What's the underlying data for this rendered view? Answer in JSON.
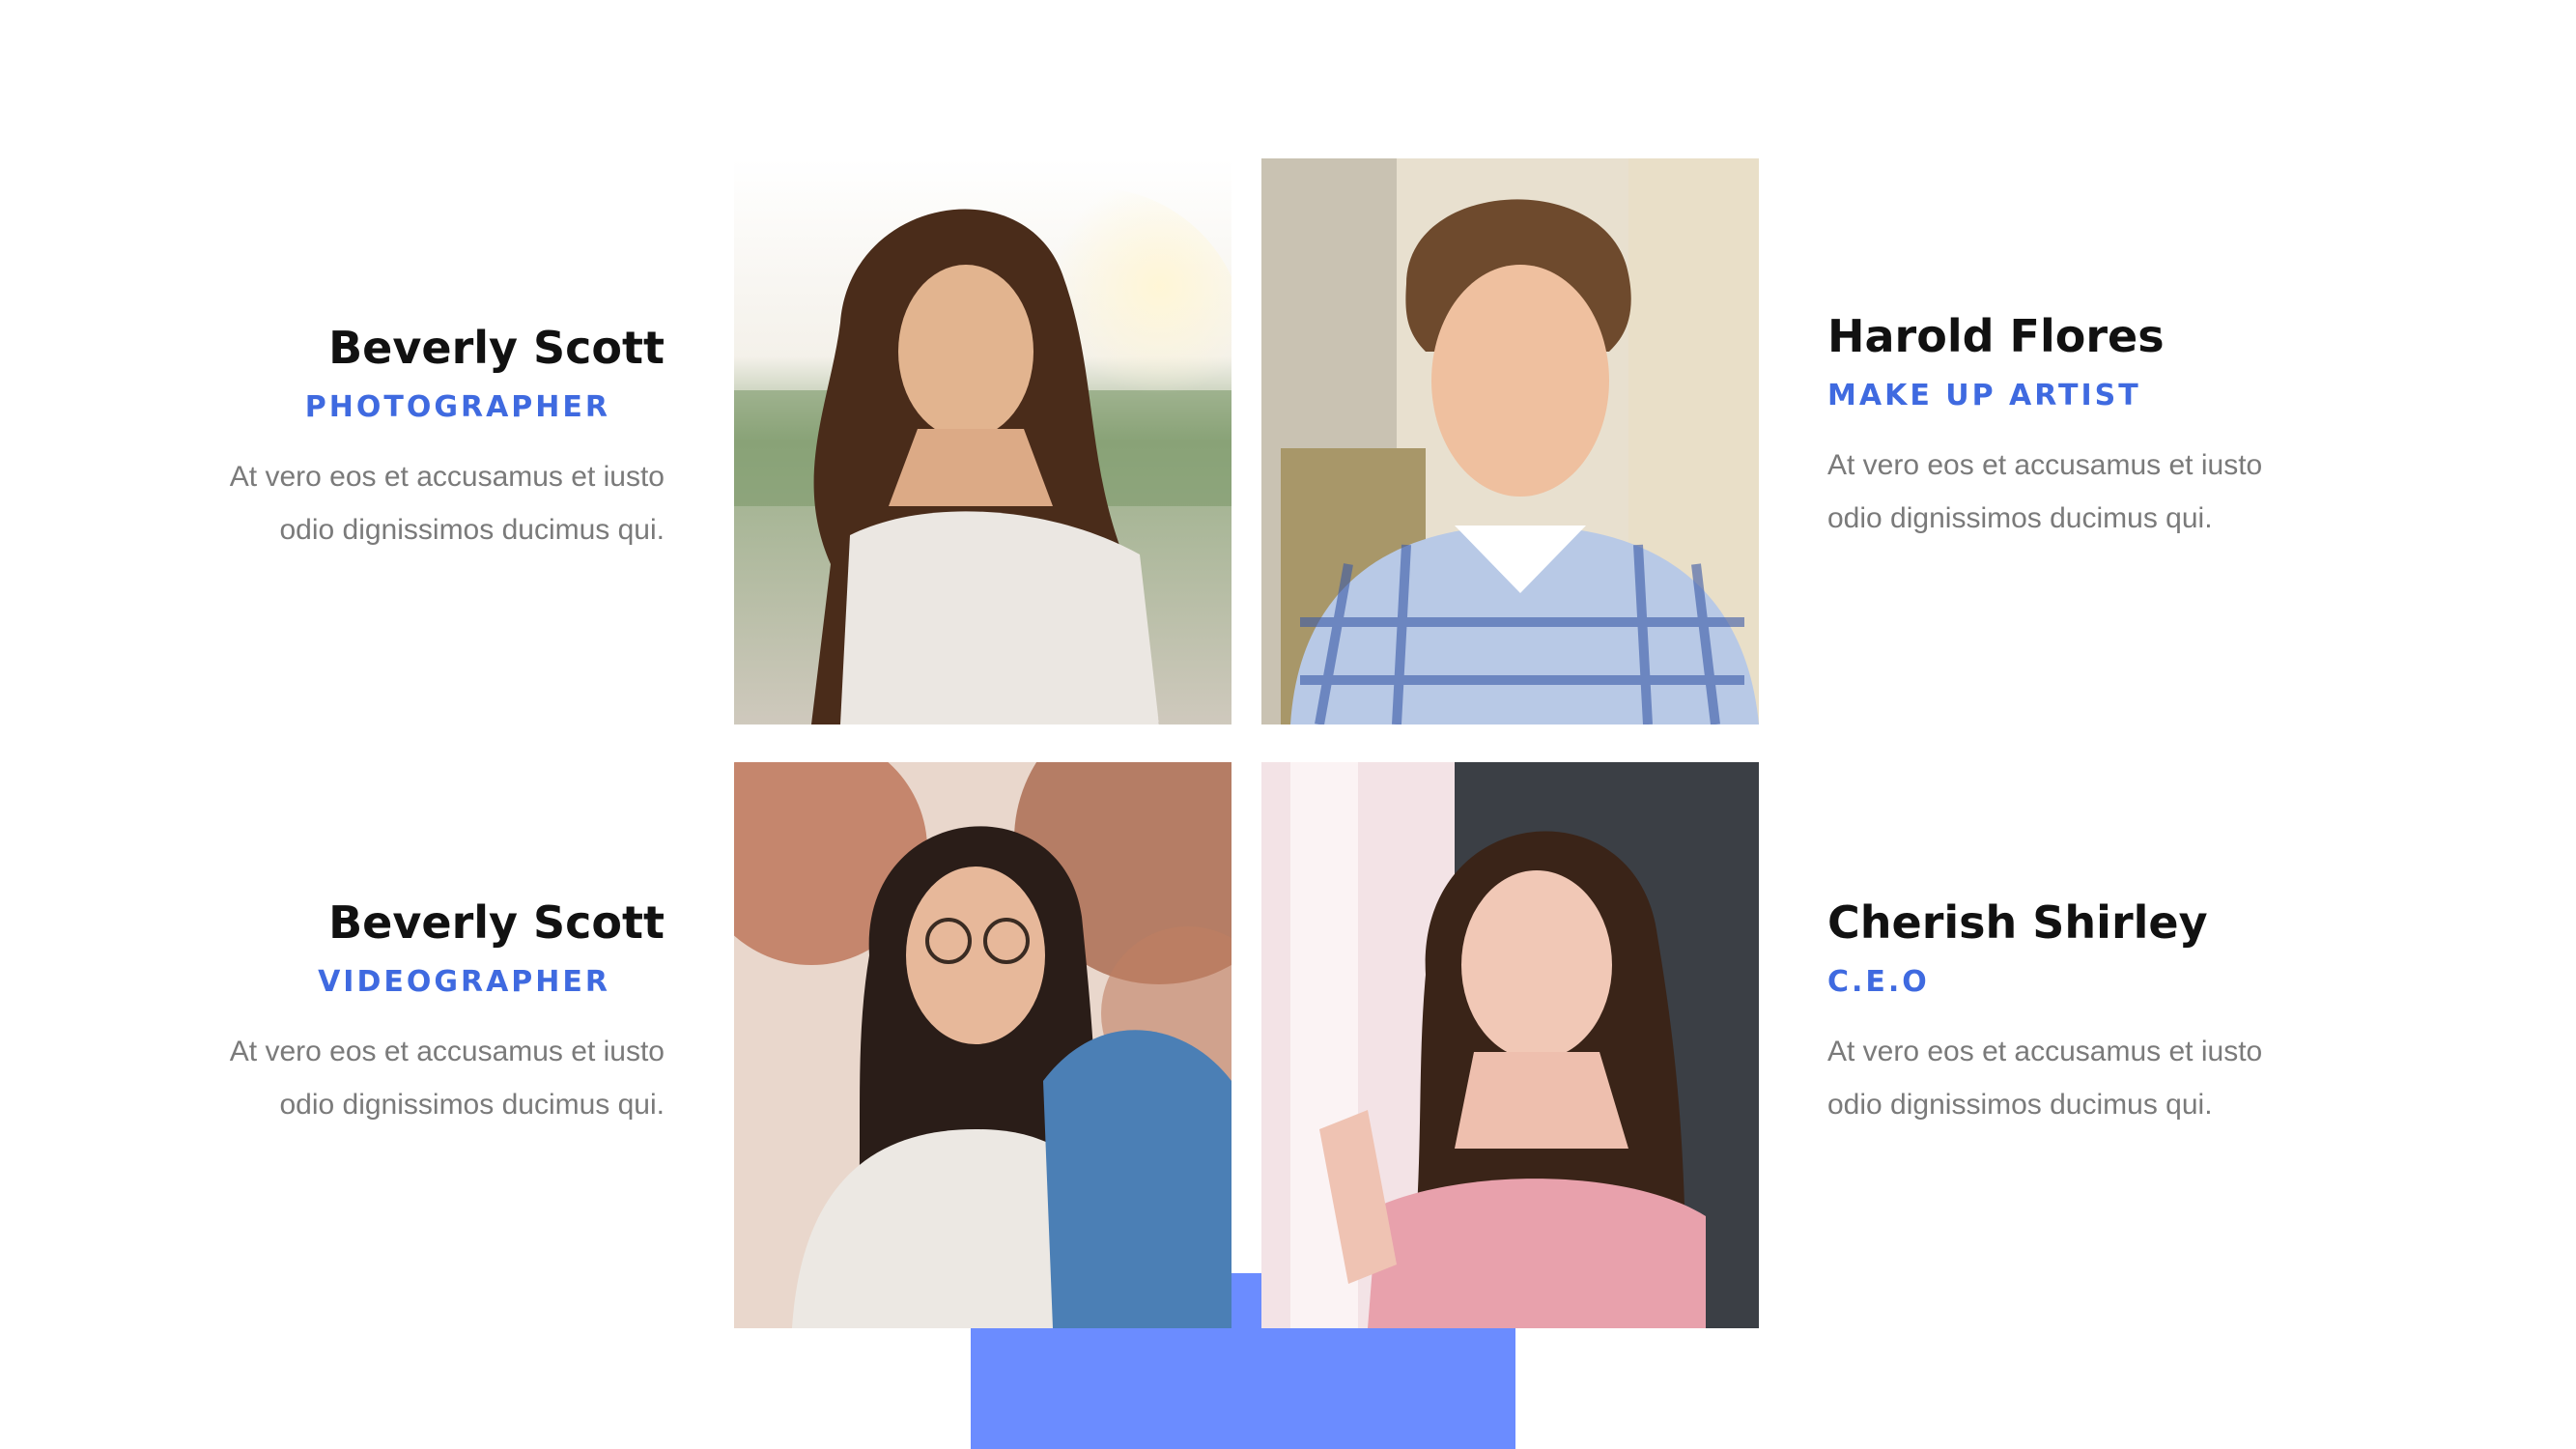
{
  "colors": {
    "accent": "#6b8cff",
    "role_text": "#3f6ae0",
    "name_text": "#111111",
    "body_text": "#7a7a7a"
  },
  "team": [
    {
      "name": "Beverly Scott",
      "role": "PHOTOGRAPHER",
      "desc_line1": "At vero eos et accusamus et iusto",
      "desc_line2": "odio dignissimos ducimus qui."
    },
    {
      "name": "Harold Flores",
      "role": "MAKE UP ARTIST",
      "desc_line1": "At vero eos et accusamus et iusto",
      "desc_line2": "odio dignissimos ducimus qui."
    },
    {
      "name": "Beverly Scott",
      "role": "VIDEOGRAPHER",
      "desc_line1": "At vero eos et accusamus et iusto",
      "desc_line2": "odio dignissimos ducimus qui."
    },
    {
      "name": "Cherish Shirley",
      "role": "C.E.O",
      "desc_line1": "At vero eos et accusamus et iusto",
      "desc_line2": "odio dignissimos ducimus qui."
    }
  ]
}
